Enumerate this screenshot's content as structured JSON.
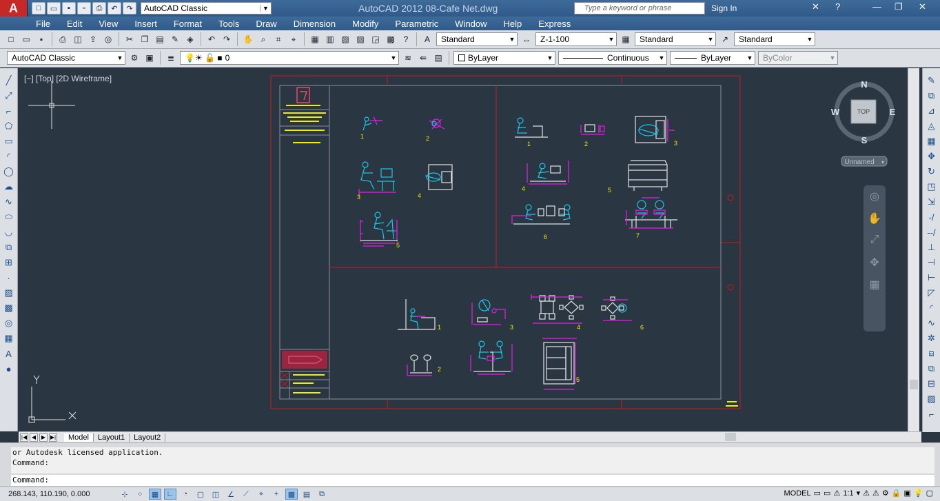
{
  "app": {
    "title": "AutoCAD 2012    08-Cafe Net.dwg",
    "app_button": "A",
    "workspace": "AutoCAD Classic",
    "search_placeholder": "Type a keyword or phrase",
    "sign_in": "Sign In"
  },
  "menu": [
    "File",
    "Edit",
    "View",
    "Insert",
    "Format",
    "Tools",
    "Draw",
    "Dimension",
    "Modify",
    "Parametric",
    "Window",
    "Help",
    "Express"
  ],
  "styles_toolbar": {
    "text_style": "Standard",
    "dim_style": "Z-1-100",
    "table_style": "Standard",
    "multileader_style": "Standard"
  },
  "layers_toolbar": {
    "workspace": "AutoCAD Classic",
    "layer": "0",
    "color": "ByLayer",
    "linetype": "Continuous",
    "lineweight": "ByLayer",
    "plotstyle": "ByColor"
  },
  "viewport": {
    "label": "[−] [Top] [2D Wireframe]",
    "viewcube": {
      "face": "TOP",
      "north": "N",
      "south": "S",
      "east": "E",
      "west": "W",
      "ucs": "Unnamed"
    }
  },
  "drawing": {
    "labels_top_left": [
      "1",
      "2",
      "3",
      "4",
      "5"
    ],
    "labels_top_right": [
      "1",
      "2",
      "3",
      "4",
      "5",
      "6",
      "7"
    ],
    "labels_bottom": [
      "1",
      "2",
      "3",
      "4",
      "5",
      "6"
    ],
    "ucs_x": "X",
    "ucs_y": "Y"
  },
  "tabs": [
    "Model",
    "Layout1",
    "Layout2"
  ],
  "command": {
    "history": [
      "or Autodesk licensed application.",
      "Command:"
    ],
    "prompt": "Command:"
  },
  "status": {
    "coords": "268.143, 110.190, 0.000",
    "space": "MODEL",
    "annotation_scale": "1:1"
  },
  "colors": {
    "canvas": "#2b3643",
    "frame_red": "#d01818",
    "frame_gray": "#8a9098",
    "cyan": "#19c8e6",
    "magenta": "#e81ce8",
    "yellow": "#f0f000"
  }
}
